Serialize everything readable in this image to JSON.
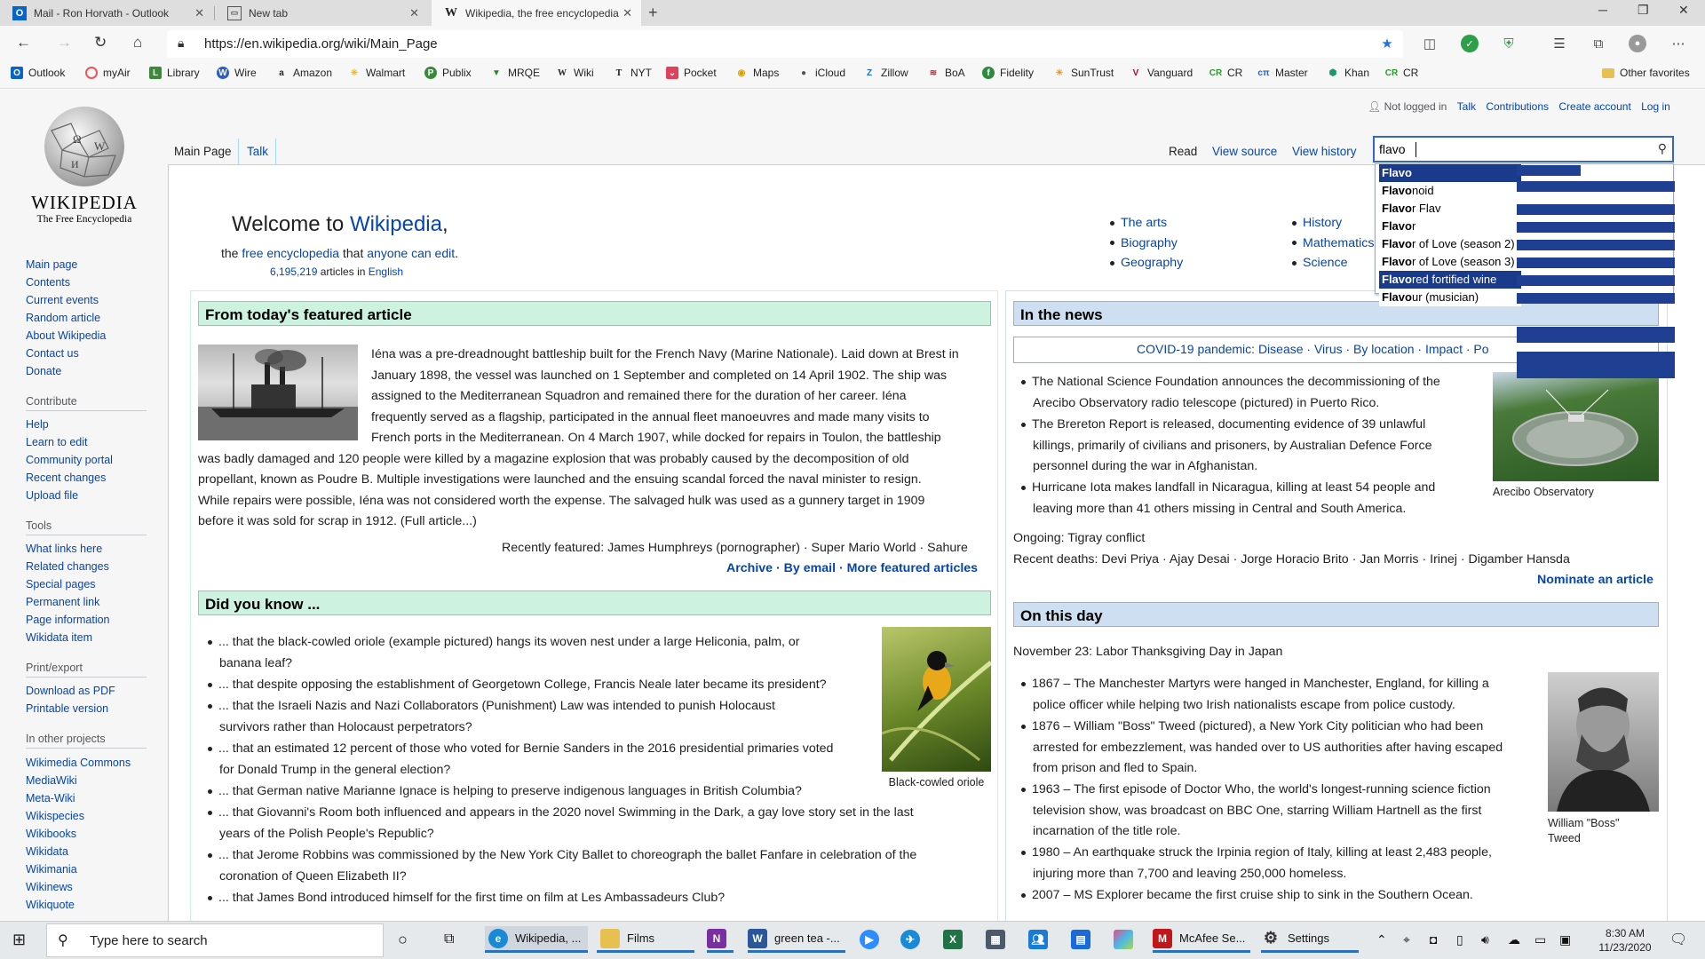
{
  "browser": {
    "tabs": [
      {
        "title": "Mail - Ron Horvath - Outlook",
        "icon": "outlook-icon"
      },
      {
        "title": "New tab",
        "icon": "newtab-icon"
      },
      {
        "title": "Wikipedia, the free encyclopedia",
        "icon": "wikipedia-icon"
      }
    ],
    "url": "https://en.wikipedia.org/wiki/Main_Page",
    "favorites": [
      "Outlook",
      "myAir",
      "Library",
      "Wire",
      "Amazon",
      "Walmart",
      "Publix",
      "MRQE",
      "Wiki",
      "NYT",
      "Pocket",
      "Maps",
      "iCloud",
      "Zillow",
      "BoA",
      "Fidelity",
      "SunTrust",
      "Vanguard",
      "CR",
      "Master",
      "Khan",
      "CR"
    ],
    "other_favorites": "Other favorites"
  },
  "wiki": {
    "logo_title": "WIKIPEDIA",
    "logo_subtitle": "The Free Encyclopedia",
    "personal": [
      "Not logged in",
      "Talk",
      "Contributions",
      "Create account",
      "Log in"
    ],
    "tabs_left": [
      "Main Page",
      "Talk"
    ],
    "tabs_right": [
      "Read",
      "View source",
      "View history"
    ],
    "search_value": "flavo",
    "suggestions": [
      {
        "pre": "Flavo",
        "post": ""
      },
      {
        "pre": "Flavo",
        "post": "noid"
      },
      {
        "pre": "Flavo",
        "post": "r Flav"
      },
      {
        "pre": "Flavo",
        "post": "r"
      },
      {
        "pre": "Flavo",
        "post": "r of Love (season 2)"
      },
      {
        "pre": "Flavo",
        "post": "r of Love (season 3)"
      },
      {
        "pre": "Flavo",
        "post": "red fortified wine"
      },
      {
        "pre": "Flavo",
        "post": "ur (musician)"
      }
    ],
    "sidebar": {
      "nav": [
        "Main page",
        "Contents",
        "Current events",
        "Random article",
        "About Wikipedia",
        "Contact us",
        "Donate"
      ],
      "contribute_hd": "Contribute",
      "contribute": [
        "Help",
        "Learn to edit",
        "Community portal",
        "Recent changes",
        "Upload file"
      ],
      "tools_hd": "Tools",
      "tools": [
        "What links here",
        "Related changes",
        "Special pages",
        "Permanent link",
        "Page information",
        "Wikidata item"
      ],
      "print_hd": "Print/export",
      "print": [
        "Download as PDF",
        "Printable version"
      ],
      "projects_hd": "In other projects",
      "projects": [
        "Wikimedia Commons",
        "MediaWiki",
        "Meta-Wiki",
        "Wikispecies",
        "Wikibooks",
        "Wikidata",
        "Wikimania",
        "Wikinews",
        "Wikiquote"
      ]
    },
    "welcome": {
      "a": "Welcome to ",
      "b": "Wikipedia",
      "c": ",",
      "line2_a": "the ",
      "line2_b": "free encyclopedia",
      "line2_c": " that ",
      "line2_d": "anyone can edit",
      "line2_e": ".",
      "count": "6,195,219",
      "count_text": " articles in ",
      "lang": "English"
    },
    "portals_col1": [
      "The arts",
      "Biography",
      "Geography"
    ],
    "portals_col2": [
      "History",
      "Mathematics",
      "Science"
    ],
    "featured_hd": "From today's featured article",
    "featured_lines": [
      "Iéna was a pre-dreadnought battleship built for the French Navy (Marine Nationale). Laid down at Brest in",
      "January 1898, the vessel was launched on 1 September and completed on 14 April 1902. The ship was",
      "assigned to the Mediterranean Squadron and remained there for the duration of her career. Iéna",
      "frequently served as a flagship, participated in the annual fleet manoeuvres and made many visits to",
      "French ports in the Mediterranean. On 4 March 1907, while docked for repairs in Toulon, the battleship",
      "was badly damaged and 120 people were killed by a magazine explosion that was probably caused by the decomposition of old",
      "propellant, known as Poudre B. Multiple investigations were launched and the ensuing scandal forced the naval minister to resign.",
      "While repairs were possible, Iéna was not considered worth the expense. The salvaged hulk was used as a gunnery target in 1909",
      "before it was sold for scrap in 1912. (Full article...)"
    ],
    "recently_featured": "Recently featured: James Humphreys (pornographer) · Super Mario World · Sahure",
    "featured_links": "Archive · By email · More featured articles",
    "dyk_hd": "Did you know ...",
    "dyk": [
      "... that the black-cowled oriole (example pictured) hangs its woven nest under a large Heliconia, palm, or",
      "banana leaf?",
      "... that despite opposing the establishment of Georgetown College, Francis Neale later became its president?",
      "... that the Israeli Nazis and Nazi Collaborators (Punishment) Law was intended to punish Holocaust",
      "survivors rather than Holocaust perpetrators?",
      "... that an estimated 12 percent of those who voted for Bernie Sanders in the 2016 presidential primaries voted",
      "for Donald Trump in the general election?",
      "... that German native Marianne Ignace is helping to preserve indigenous languages in British Columbia?",
      "... that Giovanni's Room both influenced and appears in the 2020 novel Swimming in the Dark, a gay love story set in the last",
      "years of the Polish People's Republic?",
      "... that Jerome Robbins was commissioned by the New York City Ballet to choreograph the ballet Fanfare in celebration of the",
      "coronation of Queen Elizabeth II?",
      "... that James Bond introduced himself for the first time on film at Les Ambassadeurs Club?"
    ],
    "oriole_caption": "Black-cowled oriole",
    "news_hd": "In the news",
    "covid": "COVID-19 pandemic: Disease · Virus · By location · Impact · Po",
    "news": [
      "The National Science Foundation announces the decommissioning of the",
      "Arecibo Observatory radio telescope (pictured) in Puerto Rico.",
      "The Brereton Report is released, documenting evidence of 39 unlawful",
      "killings, primarily of civilians and prisoners, by Australian Defence Force",
      "personnel during the war in Afghanistan.",
      "Hurricane Iota makes landfall in Nicaragua, killing at least 54 people and",
      "leaving more than 41 others missing in Central and South America."
    ],
    "arecibo_caption": "Arecibo Observatory",
    "ongoing": "Ongoing: Tigray conflict",
    "recent_deaths": "Recent deaths: Devi Priya · Ajay Desai · Jorge Horacio Brito · Jan Morris · Irinej · Digamber Hansda",
    "nominate": "Nominate an article",
    "otd_hd": "On this day",
    "otd_date": "November 23: Labor Thanksgiving Day in Japan",
    "otd": [
      "1867 – The Manchester Martyrs were hanged in Manchester, England, for killing a",
      "police officer while helping two Irish nationalists escape from police custody.",
      "1876 – William \"Boss\" Tweed (pictured), a New York City politician who had been",
      "arrested for embezzlement, was handed over to US authorities after having escaped",
      "from prison and fled to Spain.",
      "1963 – The first episode of Doctor Who, the world's longest-running science fiction",
      "television show, was broadcast on BBC One, starring William Hartnell as the first",
      "incarnation of the title role.",
      "1980 – An earthquake struck the Irpinia region of Italy, killing at least 2,483 people,",
      "injuring more than 7,700 and leaving 250,000 homeless.",
      "2007 – MS Explorer became the first cruise ship to sink in the Southern Ocean."
    ],
    "tweed_caption_1": "William \"Boss\"",
    "tweed_caption_2": "Tweed"
  },
  "taskbar": {
    "search_placeholder": "Type here to search",
    "items": [
      "Wikipedia, ...",
      "Films",
      "green tea -...",
      "McAfee Se...",
      "Settings"
    ],
    "time": "8:30 AM",
    "date": "11/23/2020"
  },
  "colors": {
    "link": "#0645ad",
    "featured_bg": "#cef2e0",
    "news_bg": "#cedff2",
    "suggest_hi": "#1a3a8c"
  }
}
